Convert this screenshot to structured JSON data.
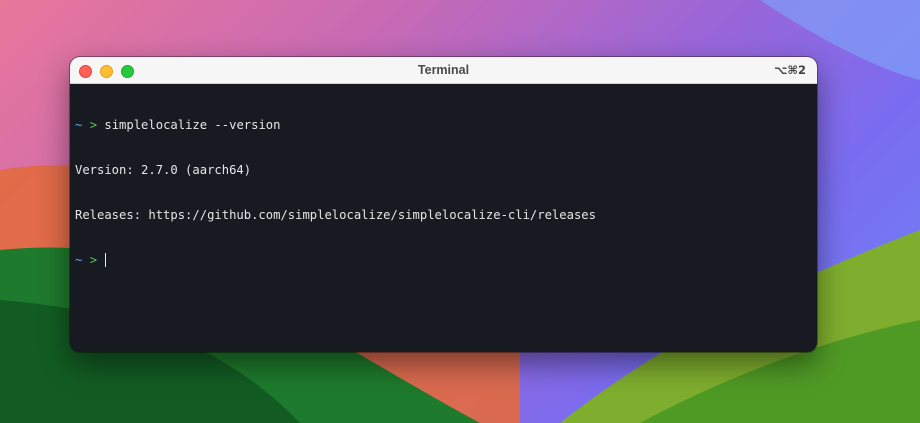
{
  "window": {
    "title": "Terminal",
    "shortcut": "⌥⌘2"
  },
  "prompt": {
    "tilde": "~",
    "arrow": ">"
  },
  "lines": {
    "command": "simplelocalize --version",
    "version": "Version: 2.7.0 (aarch64)",
    "releases": "Releases: https://github.com/simplelocalize/simplelocalize-cli/releases"
  },
  "colors": {
    "terminal_bg": "#171a21",
    "prompt_tilde": "#5fa8f0",
    "prompt_arrow": "#57c75a",
    "text": "#e6e6e6"
  }
}
